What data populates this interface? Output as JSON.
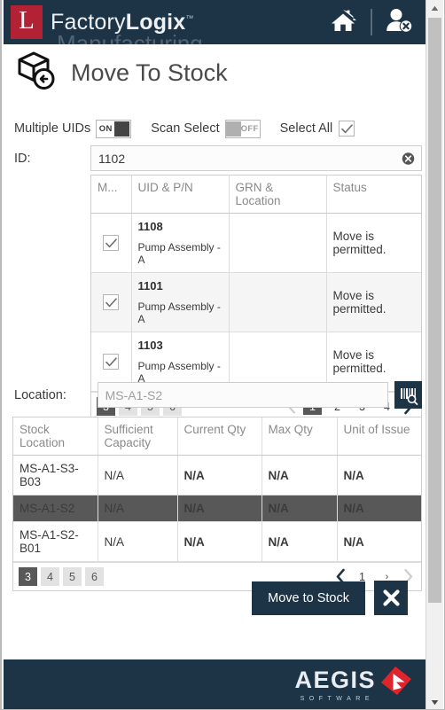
{
  "app": {
    "brand_l": "L",
    "brand_name_light": "Factory",
    "brand_name_bold": "Logix",
    "brand_tm": "™",
    "ghost_text": "Manufacturing",
    "home_icon": "home-icon",
    "user_logout_icon": "user-logout-icon"
  },
  "page": {
    "title": "Move To Stock",
    "title_icon": "move-to-stock-box-icon"
  },
  "options": {
    "multiple_uids_label": "Multiple UIDs",
    "multiple_uids_state": "ON",
    "scan_select_label": "Scan Select",
    "scan_select_state": "OFF",
    "select_all_label": "Select All",
    "select_all_checked": "✓"
  },
  "id_field": {
    "label": "ID:",
    "value": "1102",
    "placeholder": "",
    "clear_icon": "clear-circle-icon"
  },
  "uid_grid": {
    "columns": [
      "M...",
      "UID & P/N",
      "GRN & Location",
      "Status"
    ],
    "rows": [
      {
        "checked": "✓",
        "uid": "1108",
        "pn": "Pump Assembly - A",
        "grn": "",
        "status": "Move is permitted."
      },
      {
        "checked": "✓",
        "uid": "1101",
        "pn": "Pump Assembly - A",
        "grn": "",
        "status": "Move is permitted."
      },
      {
        "checked": "✓",
        "uid": "1103",
        "pn": "Pump Assembly - A",
        "grn": "",
        "status": "Move is permitted."
      }
    ],
    "pager": {
      "page_sizes": [
        "3",
        "4",
        "5",
        "6"
      ],
      "page_size_selected": "3",
      "pages": [
        "1",
        "2",
        "3",
        "4"
      ],
      "page_selected": "1",
      "prev_icon": "chevron-left-icon",
      "next_icon": "chevron-right-icon"
    }
  },
  "location_field": {
    "label": "Location:",
    "value": "",
    "placeholder": "MS-A1-S2",
    "scan_icon": "barcode-search-icon"
  },
  "stock_grid": {
    "columns": [
      "Stock Location",
      "Sufficient Capacity",
      "Current Qty",
      "Max Qty",
      "Unit of Issue"
    ],
    "rows": [
      {
        "location": "MS-A1-S3-B03",
        "capacity": "N/A",
        "current_qty": "N/A",
        "max_qty": "N/A",
        "unit_of_issue": "N/A",
        "selected": false
      },
      {
        "location": "MS-A1-S2",
        "capacity": "N/A",
        "current_qty": "N/A",
        "max_qty": "N/A",
        "unit_of_issue": "N/A",
        "selected": true
      },
      {
        "location": "MS-A1-S2-B01",
        "capacity": "N/A",
        "current_qty": "N/A",
        "max_qty": "N/A",
        "unit_of_issue": "N/A",
        "selected": false
      }
    ],
    "pager": {
      "page_sizes": [
        "3",
        "4",
        "5",
        "6"
      ],
      "page_size_selected": "3",
      "pages": [
        "1"
      ],
      "page_separator": "›",
      "prev_icon": "chevron-left-icon",
      "next_icon": "chevron-right-icon"
    }
  },
  "actions": {
    "move_to_stock_label": "Move to Stock",
    "close_icon": "close-x-icon"
  },
  "footer": {
    "aegis_name": "AEGIS",
    "aegis_sub": "SOFTWARE",
    "logo_icon": "aegis-flag-icon"
  },
  "scrollbar": {
    "up_icon": "scroll-up-arrow-icon",
    "down_icon": "scroll-down-arrow-icon"
  },
  "colors": {
    "brand_dark": "#1d3446",
    "brand_red": "#b22234",
    "row_selected": "#585858"
  }
}
